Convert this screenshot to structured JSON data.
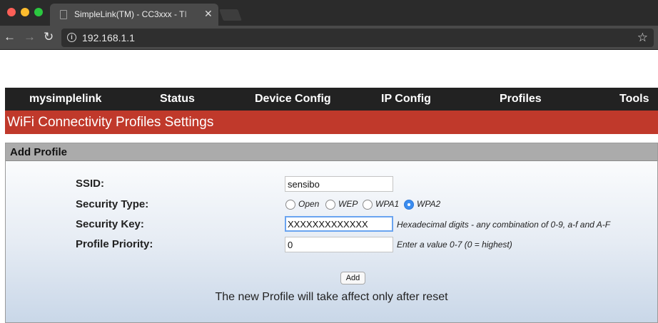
{
  "browser": {
    "tab_title": "SimpleLink(TM) - CC3xxx - TI",
    "tab_close": "✕",
    "url": "192.168.1.1"
  },
  "nav": {
    "items": [
      "mysimplelink",
      "Status",
      "Device Config",
      "IP Config",
      "Profiles",
      "Tools"
    ]
  },
  "page": {
    "heading": "WiFi Connectivity Profiles Settings"
  },
  "panel": {
    "title": "Add Profile",
    "ssid_label": "SSID:",
    "ssid_value": "sensibo",
    "security_type_label": "Security Type:",
    "security_options": [
      "Open",
      "WEP",
      "WPA1",
      "WPA2"
    ],
    "security_selected": "WPA2",
    "security_key_label": "Security Key:",
    "security_key_value": "XXXXXXXXXXXXX",
    "security_key_hint": "Hexadecimal digits - any combination of 0-9, a-f and A-F",
    "priority_label": "Profile Priority:",
    "priority_value": "0",
    "priority_hint": "Enter a value 0-7 (0 = highest)",
    "add_label": "Add",
    "note": "The new Profile will take affect only after reset"
  },
  "colors": {
    "heading_bg": "#c0392b",
    "nav_bg": "#222222",
    "radio_checked": "#3b8df0"
  }
}
